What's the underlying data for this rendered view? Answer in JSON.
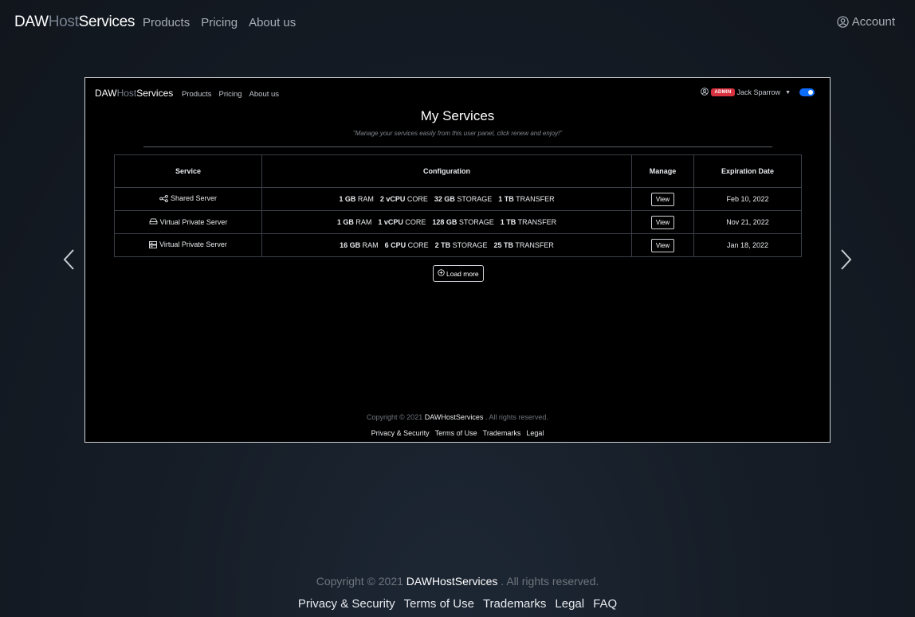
{
  "topnav": {
    "brand": {
      "part1": "DAW",
      "part2": "Host",
      "part3": "Services"
    },
    "links": [
      "Products",
      "Pricing",
      "About us"
    ],
    "account_label": "Account"
  },
  "screenshot": {
    "brand": {
      "part1": "DAW",
      "part2": "Host",
      "part3": "Services"
    },
    "links": [
      "Products",
      "Pricing",
      "About us"
    ],
    "user": {
      "badge": "ADMIN",
      "name": "Jack Sparrow"
    },
    "title": "My Services",
    "subtitle": "\"Manage your services easily from this user panel, click renew and enjoy!\"",
    "table": {
      "headers": [
        "Service",
        "Configuration",
        "Manage",
        "Expiration Date"
      ],
      "rows": [
        {
          "icon": "share-icon",
          "service": "Shared Server",
          "config": [
            [
              "1 GB",
              " RAM"
            ],
            [
              "2 vCPU",
              " CORE"
            ],
            [
              "32 GB",
              " STORAGE"
            ],
            [
              "1 TB",
              " TRANSFER"
            ]
          ],
          "manage": "View",
          "expires": "Feb 10, 2022"
        },
        {
          "icon": "hdd-icon",
          "service": "Virtual Private Server",
          "config": [
            [
              "1 GB",
              " RAM"
            ],
            [
              "1 vCPU",
              " CORE"
            ],
            [
              "128 GB",
              " STORAGE"
            ],
            [
              "1 TB",
              " TRANSFER"
            ]
          ],
          "manage": "View",
          "expires": "Nov 21, 2022"
        },
        {
          "icon": "server-icon",
          "service": "Virtual Private Server",
          "config": [
            [
              "16 GB",
              " RAM"
            ],
            [
              "6 CPU",
              " CORE"
            ],
            [
              "2 TB",
              " STORAGE"
            ],
            [
              "25 TB",
              " TRANSFER"
            ]
          ],
          "manage": "View",
          "expires": "Jan 18, 2022"
        }
      ]
    },
    "load_more": "Load more",
    "footer": {
      "copy_prefix": "Copyright © 2021 ",
      "brand": "DAWHostServices",
      "copy_suffix": " . All rights reserved.",
      "links": [
        "Privacy & Security",
        "Terms of Use",
        "Trademarks",
        "Legal"
      ]
    }
  },
  "footer": {
    "copy_prefix": "Copyright © 2021 ",
    "brand": "DAWHostServices",
    "copy_suffix": " . All rights reserved.",
    "links": [
      "Privacy & Security",
      "Terms of Use",
      "Trademarks",
      "Legal",
      "FAQ"
    ]
  },
  "colors": {
    "accent": "#0d6efd",
    "admin_badge": "#d8313f"
  }
}
